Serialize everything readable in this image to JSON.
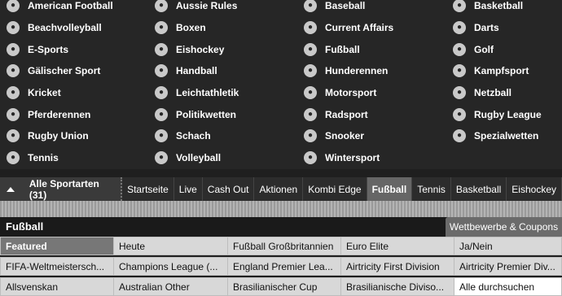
{
  "sports": [
    [
      {
        "label": "American Football",
        "icon": "american-football-icon"
      },
      {
        "label": "Beachvolleyball",
        "icon": "beachvolleyball-icon"
      },
      {
        "label": "E-Sports",
        "icon": "esports-icon"
      },
      {
        "label": "Gälischer Sport",
        "icon": "gaelic-sport-icon"
      },
      {
        "label": "Kricket",
        "icon": "cricket-icon"
      },
      {
        "label": "Pferderennen",
        "icon": "horse-racing-icon"
      },
      {
        "label": "Rugby Union",
        "icon": "rugby-union-icon"
      },
      {
        "label": "Tennis",
        "icon": "tennis-icon"
      }
    ],
    [
      {
        "label": "Aussie Rules",
        "icon": "aussie-rules-icon"
      },
      {
        "label": "Boxen",
        "icon": "boxing-icon"
      },
      {
        "label": "Eishockey",
        "icon": "ice-hockey-icon"
      },
      {
        "label": "Handball",
        "icon": "handball-icon"
      },
      {
        "label": "Leichtathletik",
        "icon": "athletics-icon"
      },
      {
        "label": "Politikwetten",
        "icon": "politics-icon"
      },
      {
        "label": "Schach",
        "icon": "chess-icon"
      },
      {
        "label": "Volleyball",
        "icon": "volleyball-icon"
      }
    ],
    [
      {
        "label": "Baseball",
        "icon": "baseball-icon"
      },
      {
        "label": "Current Affairs",
        "icon": "current-affairs-icon"
      },
      {
        "label": "Fußball",
        "icon": "football-icon"
      },
      {
        "label": "Hunderennen",
        "icon": "greyhound-icon"
      },
      {
        "label": "Motorsport",
        "icon": "motorsport-icon"
      },
      {
        "label": "Radsport",
        "icon": "cycling-icon"
      },
      {
        "label": "Snooker",
        "icon": "snooker-icon"
      },
      {
        "label": "Wintersport",
        "icon": "wintersport-icon"
      }
    ],
    [
      {
        "label": "Basketball",
        "icon": "basketball-icon"
      },
      {
        "label": "Darts",
        "icon": "darts-icon"
      },
      {
        "label": "Golf",
        "icon": "golf-icon"
      },
      {
        "label": "Kampfsport",
        "icon": "martial-arts-icon"
      },
      {
        "label": "Netzball",
        "icon": "netball-icon"
      },
      {
        "label": "Rugby League",
        "icon": "rugby-league-icon"
      },
      {
        "label": "Spezialwetten",
        "icon": "specials-icon"
      }
    ]
  ],
  "nav": {
    "all_sports_label": "Alle Sportarten (31)",
    "tabs": [
      "Startseite",
      "Live",
      "Cash Out",
      "Aktionen",
      "Kombi Edge",
      "Fußball",
      "Tennis",
      "Basketball",
      "Eishockey"
    ],
    "active_tab": "Fußball"
  },
  "section": {
    "title": "Fußball",
    "coupons_button": "Wettbewerbe & Coupons"
  },
  "competitions": [
    [
      "Featured",
      "Heute",
      "Fußball Großbritannien",
      "Euro Elite",
      "Ja/Nein"
    ],
    [
      "FIFA-Weltmeistersch...",
      "Champions League (...",
      "England Premier Lea...",
      "Airtricity First Division",
      "Airtricity Premier Div..."
    ],
    [
      "Allsvenskan",
      "Australian Other",
      "Brasilianischer Cup",
      "Brasilianische Diviso...",
      "Alle durchsuchen"
    ]
  ],
  "colors": {
    "background": "#262626",
    "active_tab": "#666666",
    "featured": "#777777",
    "cell": "#d8d8d8"
  }
}
